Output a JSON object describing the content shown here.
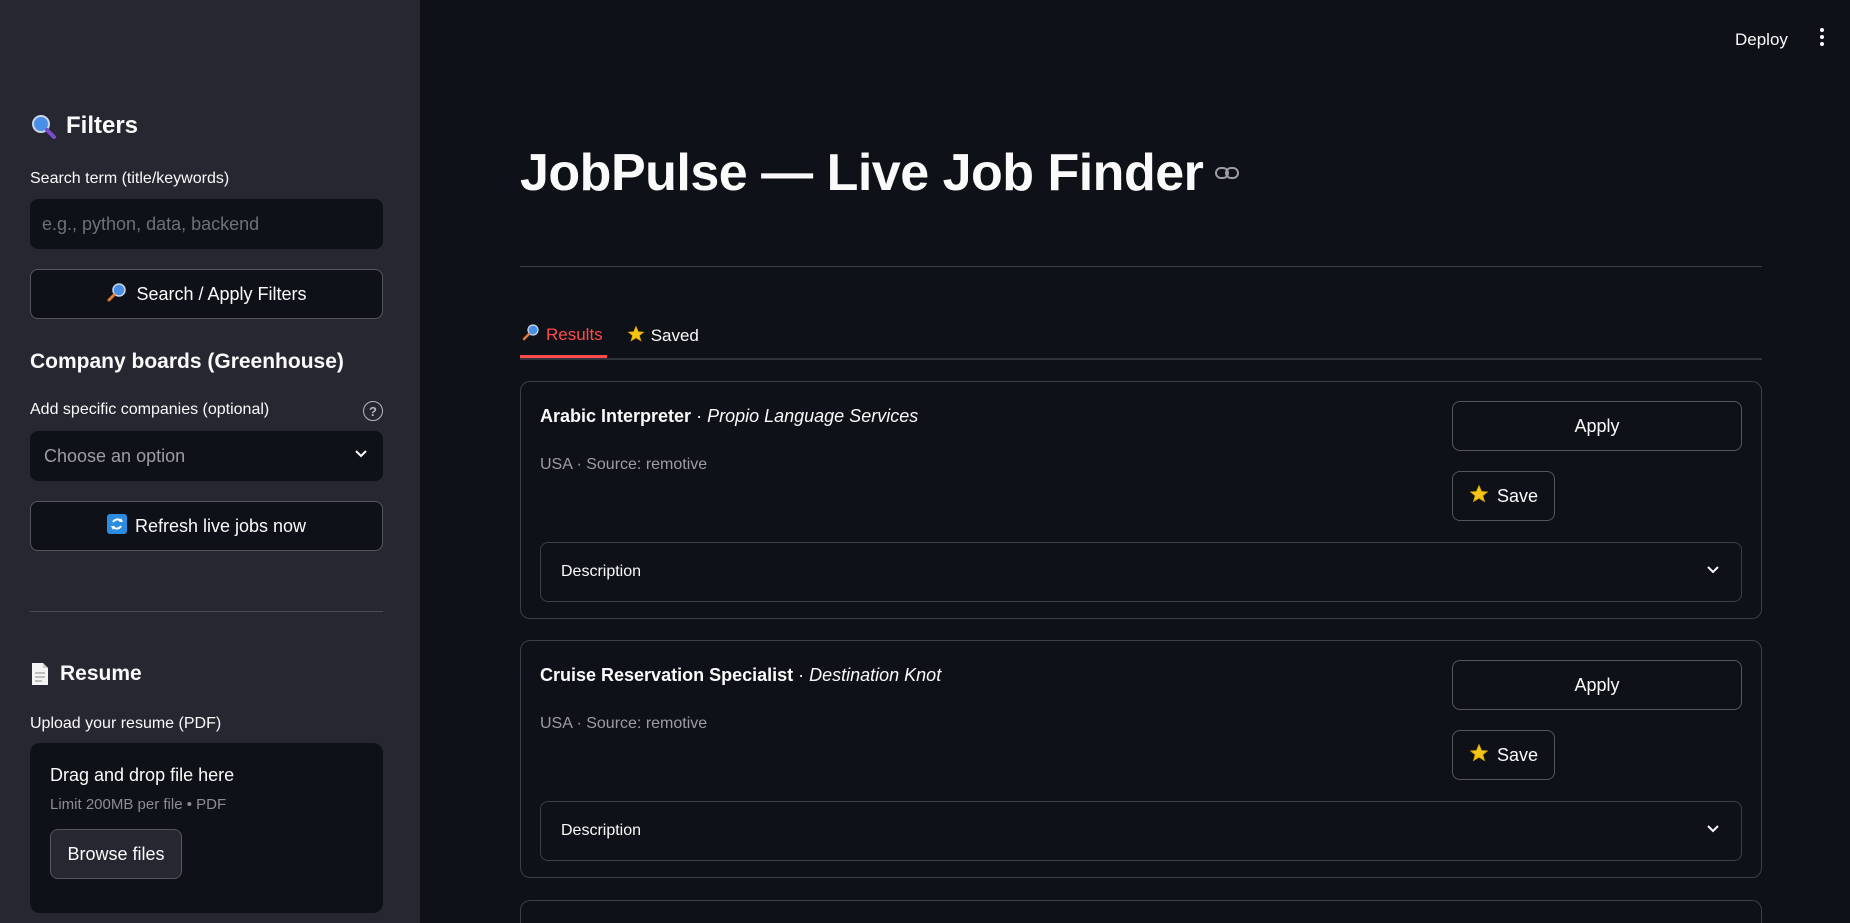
{
  "header": {
    "deploy_label": "Deploy"
  },
  "sidebar": {
    "filters_heading": "Filters",
    "search_label": "Search term (title/keywords)",
    "search_placeholder": "e.g., python, data, backend",
    "search_button": "Search / Apply Filters",
    "company_heading": "Company boards (Greenhouse)",
    "companies_label": "Add specific companies (optional)",
    "companies_select": "Choose an option",
    "refresh_button": "Refresh live jobs now",
    "resume_heading": "Resume",
    "upload_label": "Upload your resume (PDF)",
    "dropzone_title": "Drag and drop file here",
    "dropzone_limit": "Limit 200MB per file • PDF",
    "browse_button": "Browse files"
  },
  "main": {
    "title": "JobPulse — Live Job Finder",
    "tabs": [
      {
        "label": "Results",
        "active": true
      },
      {
        "label": "Saved",
        "active": false
      }
    ],
    "jobs": [
      {
        "title": "Arabic Interpreter",
        "company": "Propio Language Services",
        "meta": "USA · Source: remotive",
        "apply": "Apply",
        "save": "Save",
        "description": "Description"
      },
      {
        "title": "Cruise Reservation Specialist",
        "company": "Destination Knot",
        "meta": "USA · Source: remotive",
        "apply": "Apply",
        "save": "Save",
        "description": "Description"
      }
    ]
  },
  "colors": {
    "accent": "#ff4b4b",
    "background": "#0e1117",
    "sidebar": "#262730"
  }
}
